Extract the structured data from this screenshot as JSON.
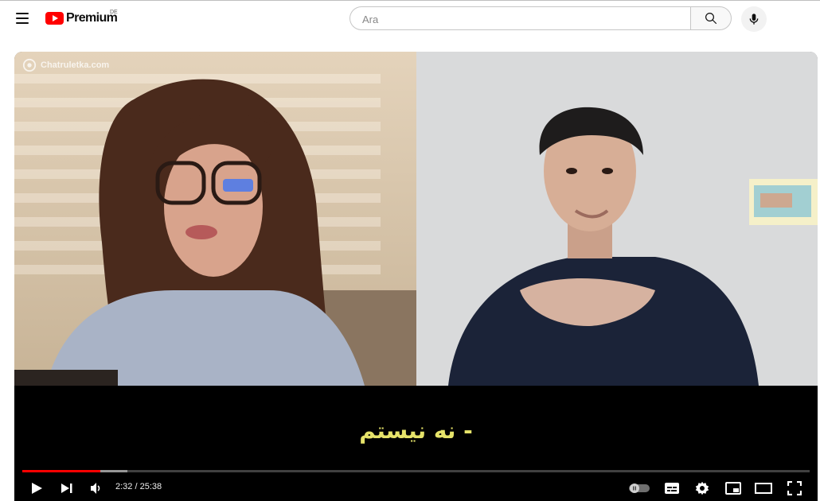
{
  "header": {
    "logo_text": "Premium",
    "country_code": "DE",
    "search_placeholder": "Ara"
  },
  "player": {
    "watermark": "Chatruletka.com",
    "caption": "- نه نیستم",
    "current_time": "2:32",
    "duration": "25:38",
    "time_display": "2:32 / 25:38",
    "progress_fraction": 0.099,
    "buffered_fraction": 0.133,
    "autoplay": "off"
  },
  "icons": {
    "menu": "hamburger-menu-icon",
    "search": "search-icon",
    "mic": "microphone-icon",
    "play": "play-icon",
    "next": "next-icon",
    "volume": "volume-icon",
    "autoplay": "autoplay-toggle-icon",
    "subtitles": "subtitles-icon",
    "settings": "gear-icon",
    "miniplayer": "miniplayer-icon",
    "theater": "theater-mode-icon",
    "fullscreen": "fullscreen-icon"
  },
  "colors": {
    "brand": "#ff0000",
    "caption": "#e6e36a",
    "progress_played": "#ff0000"
  }
}
